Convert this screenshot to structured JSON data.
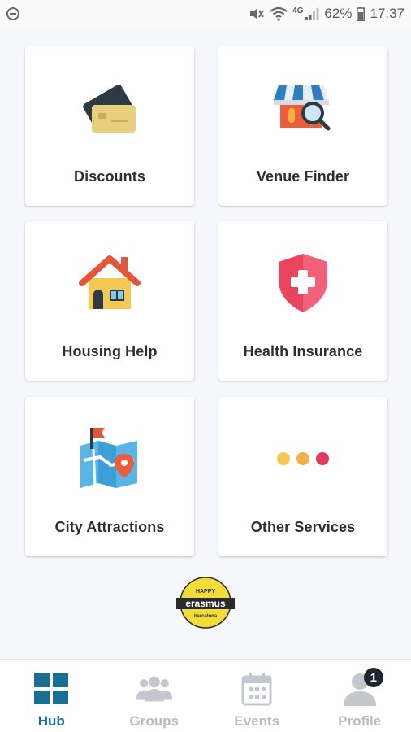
{
  "status_bar": {
    "battery": "62%",
    "time": "17:37",
    "network": "4G"
  },
  "cards": [
    {
      "label": "Discounts",
      "icon": "credit-cards-icon"
    },
    {
      "label": "Venue Finder",
      "icon": "store-search-icon"
    },
    {
      "label": "Housing Help",
      "icon": "house-icon"
    },
    {
      "label": "Health Insurance",
      "icon": "shield-cross-icon"
    },
    {
      "label": "City Attractions",
      "icon": "map-pin-icon"
    },
    {
      "label": "Other Services",
      "icon": "three-dots-icon"
    }
  ],
  "logo": {
    "top_text": "HAPPY",
    "main_text": "erasmus",
    "bottom_text": "barcelona"
  },
  "bottom_nav": {
    "items": [
      {
        "label": "Hub",
        "icon": "grid-icon",
        "active": true
      },
      {
        "label": "Groups",
        "icon": "groups-icon",
        "active": false
      },
      {
        "label": "Events",
        "icon": "calendar-icon",
        "active": false
      },
      {
        "label": "Profile",
        "icon": "person-icon",
        "active": false,
        "badge": "1"
      }
    ]
  },
  "colors": {
    "accent": "#1a6e91",
    "inactive": "#b9bcc3",
    "background": "#f7f8fb"
  }
}
